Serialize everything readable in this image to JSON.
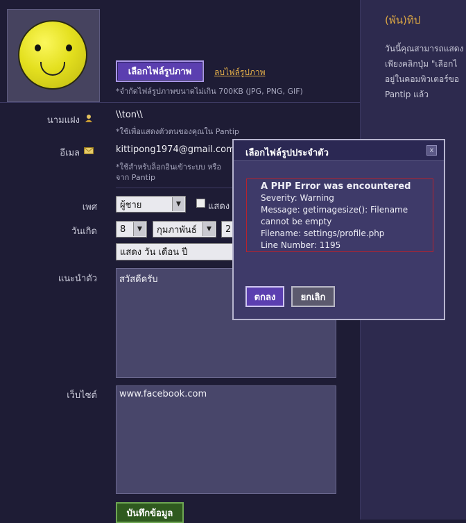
{
  "profile": {
    "choose_photo_button": "เลือกไฟล์รูปภาพ",
    "delete_photo_link": "ลบไฟล์รูปภาพ",
    "photo_hint": "*จำกัดไฟล์รูปภาพขนาดไม่เกิน 700KB (JPG, PNG, GIF)"
  },
  "fields": {
    "alias_label": "นามแฝง",
    "alias_value": "\\\\ton\\\\",
    "alias_hint": "*ใช้เพื่อแสดงตัวตนของคุณใน Pantip",
    "email_label": "อีเมล",
    "email_value": "kittipong1974@gmail.com",
    "email_hint_1": "*ใช้สำหรับล็อกอินเข้าระบบ หรือ",
    "email_hint_2": "จาก Pantip",
    "gender_label": "เพศ",
    "gender_value": "ผู้ชาย",
    "gender_show_label": "แสดง",
    "birthday_label": "วันเกิด",
    "birthday_day": "8",
    "birthday_month": "กุมภาพันธ์",
    "birthday_year": "2",
    "birthday_display": "แสดง วัน เดือน ปี",
    "intro_label": "แนะนำตัว",
    "intro_value": "สวัสดีครับ",
    "website_label": "เว็บไซต์",
    "website_value": "www.facebook.com",
    "save_button": "บันทึกข้อมูล"
  },
  "tip": {
    "title": "(พัน)ทิป",
    "line1": "วันนี้คุณสามารถแสดง",
    "line2": "เพียงคลิกปุ่ม \"เลือกไ",
    "line3": "อยู่ในคอมพิวเตอร์ขอ",
    "line4": "Pantip แล้ว"
  },
  "dialog": {
    "title": "เลือกไฟล์รูปประจำตัว",
    "close_label": "x",
    "error_heading": "A PHP Error was encountered",
    "severity": "Severity: Warning",
    "message_1": "Message: getimagesize(): Filename",
    "message_2": "cannot be empty",
    "filename": "Filename: settings/profile.php",
    "line_number": "Line Number: 1195",
    "ok_button": "ตกลง",
    "cancel_button": "ยกเลิก"
  },
  "colors": {
    "background": "#1e1c35",
    "accent_purple": "#5b3fb0",
    "link_gold": "#e6b04a",
    "error_red": "#b8222d",
    "save_green": "#2f5a1f"
  }
}
